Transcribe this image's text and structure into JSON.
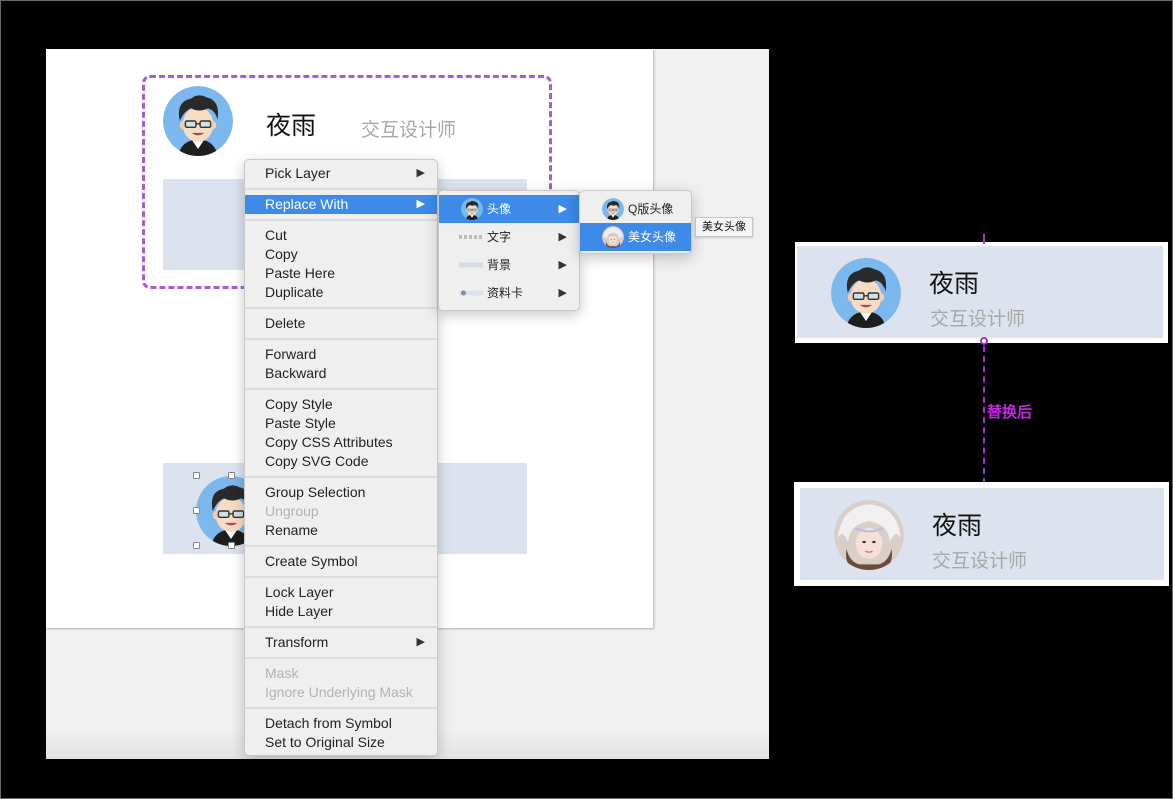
{
  "artboard": {
    "card_top": {
      "name": "夜雨",
      "role": "交互设计师",
      "avatar": "cartoon-male-avatar"
    },
    "card_selected": {
      "avatar": "cartoon-male-avatar"
    }
  },
  "context_menu": {
    "items": [
      {
        "label": "Pick Layer",
        "submenu": true,
        "disabled": false
      },
      {
        "separator": true
      },
      {
        "label": "Replace With",
        "submenu": true,
        "disabled": false,
        "highlighted": true
      },
      {
        "separator": true
      },
      {
        "label": "Cut"
      },
      {
        "label": "Copy"
      },
      {
        "label": "Paste Here"
      },
      {
        "label": "Duplicate"
      },
      {
        "separator": true
      },
      {
        "label": "Delete"
      },
      {
        "separator": true
      },
      {
        "label": "Forward"
      },
      {
        "label": "Backward"
      },
      {
        "separator": true
      },
      {
        "label": "Copy Style"
      },
      {
        "label": "Paste Style"
      },
      {
        "label": "Copy CSS Attributes"
      },
      {
        "label": "Copy SVG Code"
      },
      {
        "separator": true
      },
      {
        "label": "Group Selection"
      },
      {
        "label": "Ungroup",
        "disabled": true
      },
      {
        "label": "Rename"
      },
      {
        "separator": true
      },
      {
        "label": "Create Symbol"
      },
      {
        "separator": true
      },
      {
        "label": "Lock Layer"
      },
      {
        "label": "Hide Layer"
      },
      {
        "separator": true
      },
      {
        "label": "Transform",
        "submenu": true
      },
      {
        "separator": true
      },
      {
        "label": "Mask",
        "disabled": true
      },
      {
        "label": "Ignore Underlying Mask",
        "disabled": true
      },
      {
        "separator": true
      },
      {
        "label": "Detach from Symbol"
      },
      {
        "label": "Set to Original Size"
      }
    ],
    "replace_submenu": [
      {
        "label": "头像",
        "thumb": "avatar",
        "highlighted": true
      },
      {
        "label": "文字",
        "thumb": "text"
      },
      {
        "label": "背景",
        "thumb": "background"
      },
      {
        "label": "资料卡",
        "thumb": "card"
      }
    ],
    "avatar_submenu": [
      {
        "label": "Q版头像",
        "thumb": "cartoon-avatar"
      },
      {
        "label": "美女头像",
        "thumb": "photo-avatar",
        "highlighted": true
      }
    ],
    "tooltip": "美女头像"
  },
  "comparison": {
    "before": {
      "name": "夜雨",
      "role": "交互设计师",
      "avatar": "cartoon-male-avatar"
    },
    "label": "替换后",
    "after": {
      "name": "夜雨",
      "role": "交互设计师",
      "avatar": "photo-female-avatar"
    }
  },
  "colors": {
    "accent_highlight": "#3d8ae8",
    "selection_dash": "#a95ad4",
    "annotation": "#c32ae0",
    "card_bg": "#dce3ef"
  }
}
